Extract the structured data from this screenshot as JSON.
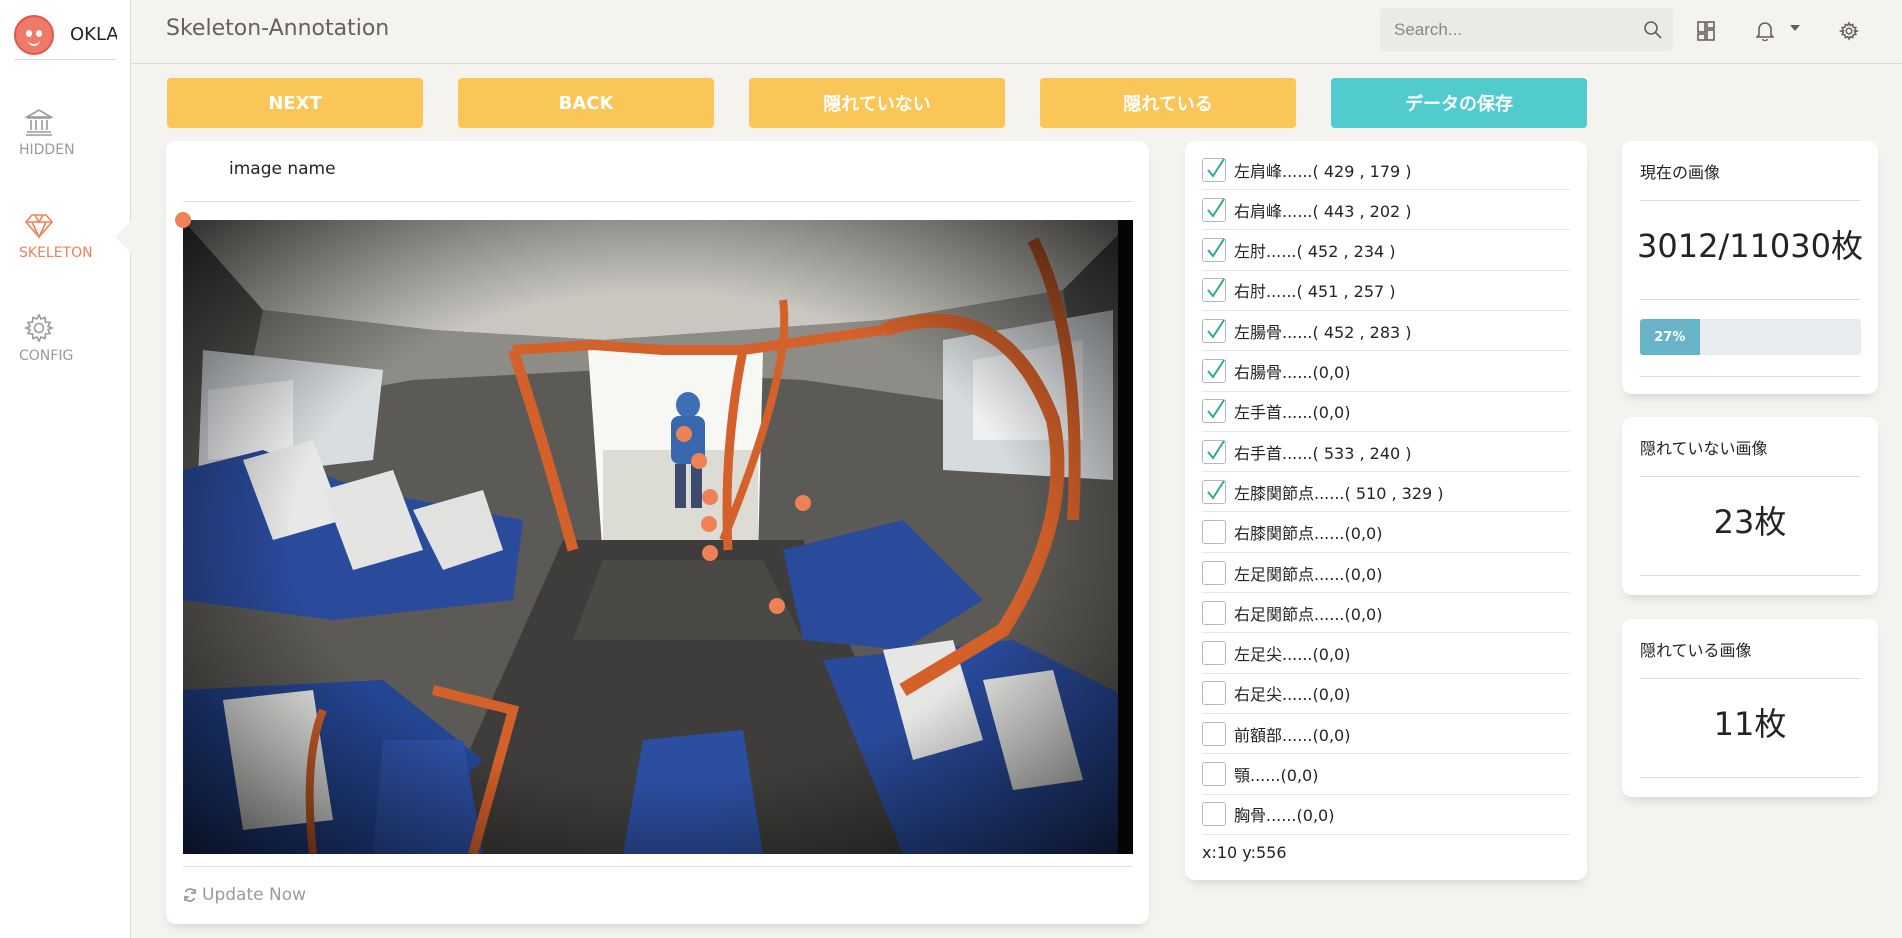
{
  "app": {
    "logo_text": "OKLA",
    "page_title": "Skeleton-Annotation"
  },
  "sidebar": {
    "items": [
      {
        "label": "HIDDEN",
        "icon": "bank-icon",
        "active": false
      },
      {
        "label": "SKELETON",
        "icon": "diamond-icon",
        "active": true
      },
      {
        "label": "CONFIG",
        "icon": "gear-icon",
        "active": false
      }
    ]
  },
  "header": {
    "search_placeholder": "Search..."
  },
  "toolbar": {
    "next": "NEXT",
    "back": "BACK",
    "not_hidden": "隠れていない",
    "hidden": "隠れている",
    "save": "データの保存"
  },
  "image_panel": {
    "image_name_label": "image name",
    "update_label": "Update Now"
  },
  "joints": [
    {
      "label": "左肩峰......( 429 , 179 )",
      "checked": true
    },
    {
      "label": "右肩峰......( 443 , 202 )",
      "checked": true
    },
    {
      "label": "左肘......( 452 , 234 )",
      "checked": true
    },
    {
      "label": "右肘......( 451 , 257 )",
      "checked": true
    },
    {
      "label": "左腸骨......( 452 , 283 )",
      "checked": true
    },
    {
      "label": "右腸骨......(0,0)",
      "checked": true
    },
    {
      "label": "左手首......(0,0)",
      "checked": true
    },
    {
      "label": "右手首......( 533 , 240 )",
      "checked": true
    },
    {
      "label": "左膝関節点......( 510 , 329 )",
      "checked": true
    },
    {
      "label": "右膝関節点......(0,0)",
      "checked": false
    },
    {
      "label": "左足関節点......(0,0)",
      "checked": false
    },
    {
      "label": "右足関節点......(0,0)",
      "checked": false
    },
    {
      "label": "左足尖......(0,0)",
      "checked": false
    },
    {
      "label": "右足尖......(0,0)",
      "checked": false
    },
    {
      "label": "前額部......(0,0)",
      "checked": false
    },
    {
      "label": "顎......(0,0)",
      "checked": false
    },
    {
      "label": "胸骨......(0,0)",
      "checked": false
    }
  ],
  "cursor_readout": "x:10 y:556",
  "stats": {
    "current": {
      "title": "現在の画像",
      "value": "3012/11030枚",
      "progress_label": "27%",
      "progress": 0.27
    },
    "not_hidden": {
      "title": "隠れていない画像",
      "value": "23枚"
    },
    "hidden": {
      "title": "隠れている画像",
      "value": "11枚"
    }
  },
  "colors": {
    "accent_orange": "#ef8157",
    "button_yellow": "#fbc658",
    "button_teal": "#51cbce",
    "progress_blue": "#68b3c8"
  }
}
